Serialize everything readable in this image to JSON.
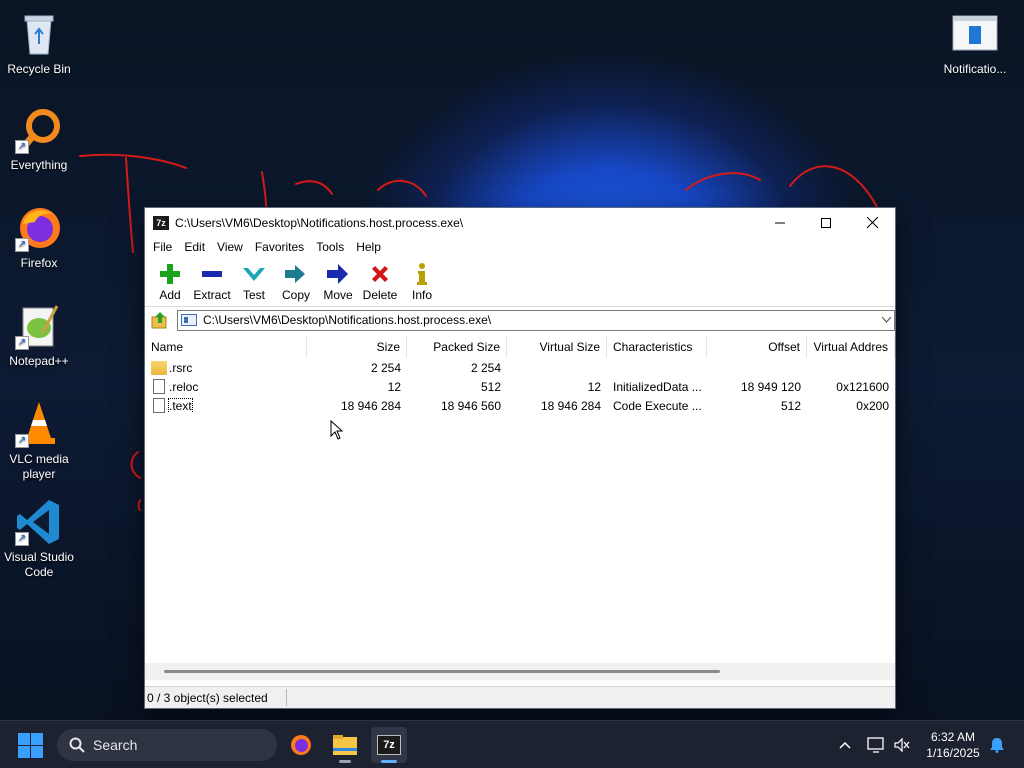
{
  "desktop": {
    "icons": [
      {
        "label": "Recycle Bin"
      },
      {
        "label": "Everything"
      },
      {
        "label": "Firefox"
      },
      {
        "label": "Notepad++"
      },
      {
        "label": "VLC media player"
      },
      {
        "label": "Visual Studio Code"
      },
      {
        "label": "Notificatio..."
      }
    ]
  },
  "window": {
    "icon_text": "7z",
    "title": "C:\\Users\\VM6\\Desktop\\Notifications.host.process.exe\\",
    "menu": [
      "File",
      "Edit",
      "View",
      "Favorites",
      "Tools",
      "Help"
    ],
    "toolbar": [
      {
        "label": "Add",
        "icon": "plus-icon",
        "color": "#1aa31a"
      },
      {
        "label": "Extract",
        "icon": "minus-icon",
        "color": "#1b2bb0"
      },
      {
        "label": "Test",
        "icon": "checkmark-icon",
        "color": "#19a6b5"
      },
      {
        "label": "Copy",
        "icon": "double-arrow-icon",
        "color": "#1d7a8f"
      },
      {
        "label": "Move",
        "icon": "arrow-right-icon",
        "color": "#1b2bb0"
      },
      {
        "label": "Delete",
        "icon": "x-icon",
        "color": "#d01818"
      },
      {
        "label": "Info",
        "icon": "info-icon",
        "color": "#b8a000"
      }
    ],
    "address": "C:\\Users\\VM6\\Desktop\\Notifications.host.process.exe\\",
    "columns": [
      "Name",
      "Size",
      "Packed Size",
      "Virtual Size",
      "Characteristics",
      "Offset",
      "Virtual Addres"
    ],
    "rows": [
      {
        "type": "folder",
        "name": ".rsrc",
        "size": "2 254",
        "packed": "2 254",
        "vsize": "",
        "characteristics": "",
        "offset": "",
        "vaddr": ""
      },
      {
        "type": "file",
        "name": ".reloc",
        "size": "12",
        "packed": "512",
        "vsize": "12",
        "characteristics": "InitializedData ...",
        "offset": "18 949 120",
        "vaddr": "0x121600"
      },
      {
        "type": "file",
        "name": ".text",
        "size": "18 946 284",
        "packed": "18 946 560",
        "vsize": "18 946 284",
        "characteristics": "Code Execute ...",
        "offset": "512",
        "vaddr": "0x200"
      }
    ],
    "status": "0 / 3 object(s) selected"
  },
  "taskbar": {
    "search_placeholder": "Search",
    "time": "6:32 AM",
    "date": "1/16/2025",
    "apps": [
      "firefox-icon",
      "file-explorer-icon",
      "7zip-icon"
    ]
  }
}
